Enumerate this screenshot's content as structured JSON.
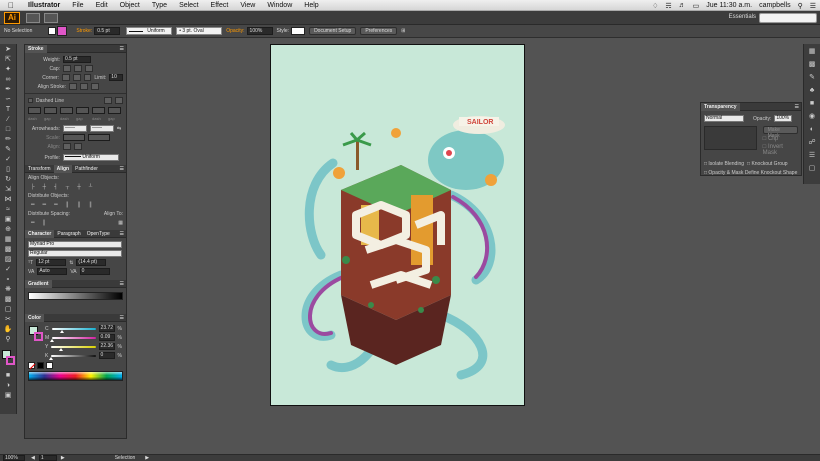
{
  "menubar": {
    "app_name": "Illustrator",
    "items": [
      "File",
      "Edit",
      "Object",
      "Type",
      "Select",
      "Effect",
      "View",
      "Window",
      "Help"
    ],
    "clock": "Jue 11:30 a.m.",
    "user": "campbells"
  },
  "appbar": {
    "logo": "Ai",
    "workspace": "Essentials"
  },
  "control_bar": {
    "selection": "No Selection",
    "stroke_label": "Stroke:",
    "stroke_value": "0.5 pt",
    "profile_value": "Uniform",
    "brush_value": "3 pt. Oval",
    "opacity_label": "Opacity:",
    "opacity_value": "100%",
    "style_label": "Style:",
    "document_setup": "Document Setup",
    "preferences": "Preferences",
    "fill_color": "#ffffff",
    "stroke_color": "#e056c8"
  },
  "stroke_panel": {
    "title": "Stroke",
    "weight_label": "Weight:",
    "weight_value": "0.5 pt",
    "cap_label": "Cap:",
    "corner_label": "Corner:",
    "limit_label": "Limit:",
    "limit_value": "10",
    "align_label": "Align Stroke:",
    "dashed_label": "Dashed Line",
    "dash_fields": [
      "dash",
      "gap",
      "dash",
      "gap",
      "dash",
      "gap"
    ],
    "arrowheads_label": "Arrowheads:",
    "scale_label": "Scale:",
    "align2_label": "Align:",
    "profile_label": "Profile:",
    "profile_value": "Uniform"
  },
  "align_panel": {
    "tabs": [
      "Transform",
      "Align",
      "Pathfinder"
    ],
    "align_objects": "Align Objects:",
    "distribute_objects": "Distribute Objects:",
    "distribute_spacing": "Distribute Spacing:",
    "align_to": "Align To:"
  },
  "character_panel": {
    "tabs": [
      "Character",
      "Paragraph",
      "OpenType"
    ],
    "font": "Myriad Pro",
    "style": "Regular",
    "size": "12 pt",
    "leading": "(14.4 pt)",
    "kerning": "Auto",
    "tracking": "0"
  },
  "gradient_panel": {
    "title": "Gradient"
  },
  "color_panel": {
    "title": "Color",
    "channels": [
      {
        "label": "C",
        "value": "23.72",
        "level": 0.237,
        "color": "#18b0d0"
      },
      {
        "label": "M",
        "value": "0.09",
        "level": 0.001,
        "color": "#d020a0"
      },
      {
        "label": "Y",
        "value": "22.36",
        "level": 0.224,
        "color": "#d8d000"
      },
      {
        "label": "K",
        "value": "0",
        "level": 0.0,
        "color": "#111111"
      }
    ]
  },
  "transparency_panel": {
    "title": "Transparency",
    "mode": "Normal",
    "opacity_label": "Opacity:",
    "opacity_value": "100%",
    "make_mask": "Make Mask",
    "clip": "Clip",
    "invert_mask": "Invert Mask",
    "isolate_blending": "Isolate Blending",
    "knockout_group": "Knockout Group",
    "opacity_mask": "Opacity & Mask Define Knockout Shape"
  },
  "artwork": {
    "sign_text": "SAILOR",
    "word": "PLANET",
    "background": "#c8e8d8"
  },
  "statusbar": {
    "zoom": "100%",
    "page": "1",
    "mode": "Selection"
  }
}
